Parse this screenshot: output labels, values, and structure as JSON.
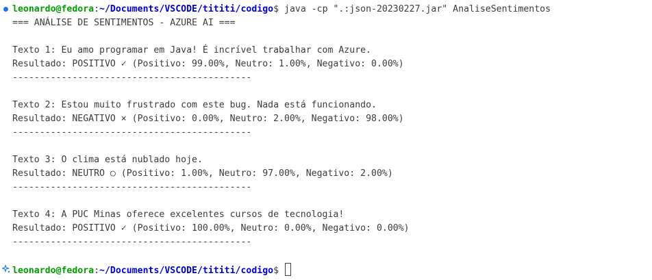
{
  "terminal": {
    "prompt": {
      "user_host": "leonardo@fedora",
      "separator": ":",
      "path": "~/Documents/VSCODE/tititi/codigo",
      "symbol": "$ "
    },
    "command": "java -cp \".:json-20230227.jar\" AnaliseSentimentos",
    "title_line": "=== ANÁLISE DE SENTIMENTOS - AZURE AI ===",
    "results": [
      {
        "text": "Texto 1: Eu amo programar em Java! É incrível trabalhar com Azure.",
        "result": "Resultado: POSITIVO ✓ (Positivo: 99.00%, Neutro: 1.00%, Negativo: 0.00%)"
      },
      {
        "text": "Texto 2: Estou muito frustrado com este bug. Nada está funcionando.",
        "result": "Resultado: NEGATIVO × (Positivo: 0.00%, Neutro: 2.00%, Negativo: 98.00%)"
      },
      {
        "text": "Texto 3: O clima está nublado hoje.",
        "result": "Resultado: NEUTRO ○ (Positivo: 1.00%, Neutro: 97.00%, Negativo: 2.00%)"
      },
      {
        "text": "Texto 4: A PUC Minas oferece excelentes cursos de tecnologia!",
        "result": "Resultado: POSITIVO ✓ (Positivo: 100.00%, Neutro: 0.00%, Negativo: 0.00%)"
      }
    ],
    "separator_line": "--------------------------------------------",
    "colors": {
      "user_host": "#00a000",
      "path": "#0000d8",
      "text": "#3b3b3b",
      "decoration": "#1a73e8",
      "background": "#ffffff"
    },
    "icons": {
      "command_status": "circle-dot-icon",
      "prompt_action": "sparkle-icon",
      "cursor": "block-cursor"
    }
  }
}
